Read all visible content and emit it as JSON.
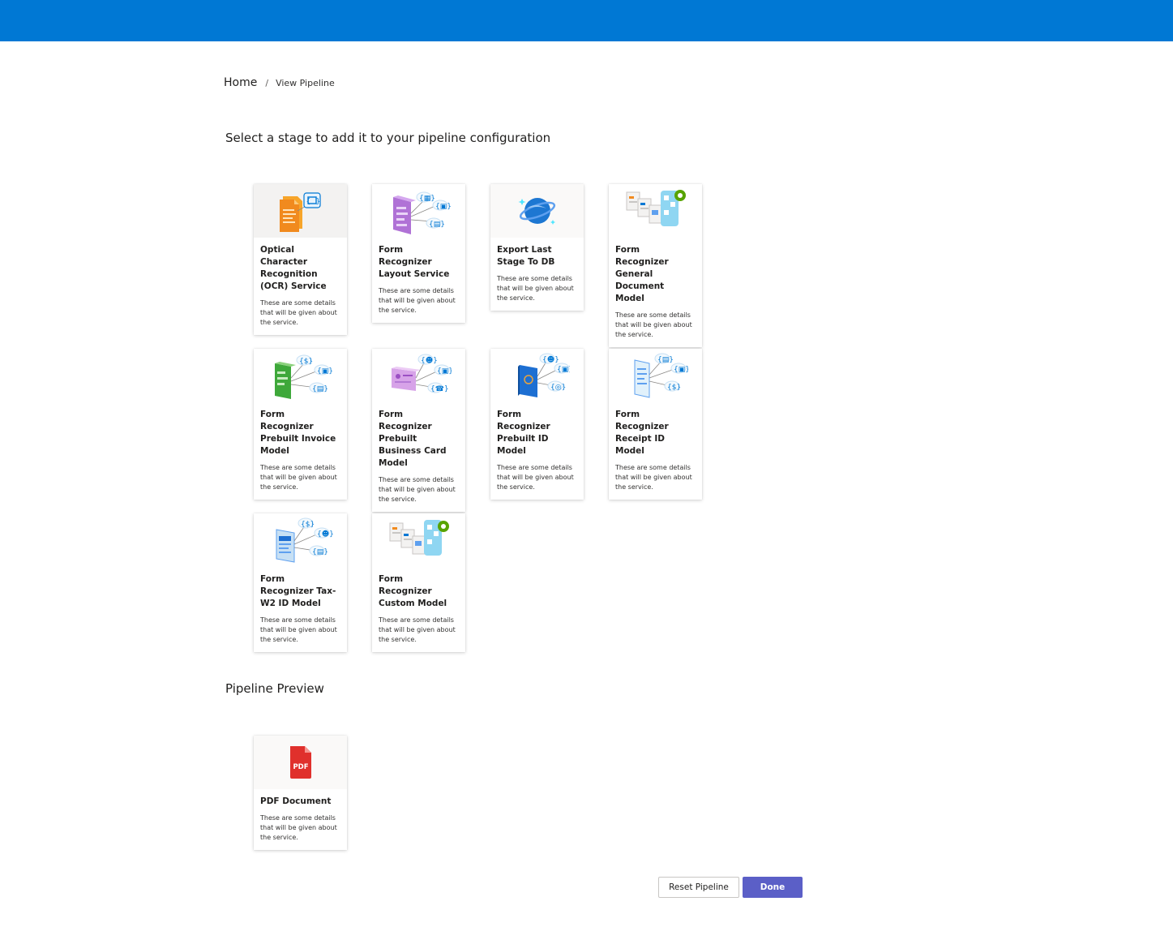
{
  "breadcrumb": {
    "home": "Home",
    "separator": "/",
    "current": "View Pipeline"
  },
  "stages_title": "Select a stage to add it to your pipeline configuration",
  "preview_title": "Pipeline Preview",
  "stages": [
    {
      "title": "Optical Character Recognition (OCR) Service",
      "desc": "These are some details that will be given about the service.",
      "icon": "ocr-document-icon"
    },
    {
      "title": "Form Recognizer Layout Service",
      "desc": "These are some details that will be given about the service.",
      "icon": "layout-form-icon"
    },
    {
      "title": "Export Last Stage To DB",
      "desc": "These are some details that will be given about the service.",
      "icon": "cosmos-db-icon"
    },
    {
      "title": "Form Recognizer General Document Model",
      "desc": "These are some details that will be given about the service.",
      "icon": "general-document-icon"
    },
    {
      "title": "Form Recognizer Prebuilt Invoice Model",
      "desc": "These are some details that will be given about the service.",
      "icon": "invoice-icon"
    },
    {
      "title": "Form Recognizer Prebuilt Business Card Model",
      "desc": "These are some details that will be given about the service.",
      "icon": "business-card-icon"
    },
    {
      "title": "Form Recognizer Prebuilt ID Model",
      "desc": "These are some details that will be given about the service.",
      "icon": "passport-icon"
    },
    {
      "title": "Form Recognizer Receipt ID Model",
      "desc": "These are some details that will be given about the service.",
      "icon": "receipt-icon"
    },
    {
      "title": "Form Recognizer Tax-W2 ID Model",
      "desc": "These are some details that will be given about the service.",
      "icon": "tax-w2-icon"
    },
    {
      "title": "Form Recognizer Custom Model",
      "desc": "These are some details that will be given about the service.",
      "icon": "custom-model-icon"
    }
  ],
  "preview": [
    {
      "title": "PDF Document",
      "desc": "These are some details that will be given about the service.",
      "icon": "pdf-icon",
      "icon_label": "PDF"
    }
  ],
  "buttons": {
    "reset": "Reset Pipeline",
    "done": "Done"
  },
  "colors": {
    "topbar": "#0078d4",
    "primary_button": "#5b5fc7"
  }
}
